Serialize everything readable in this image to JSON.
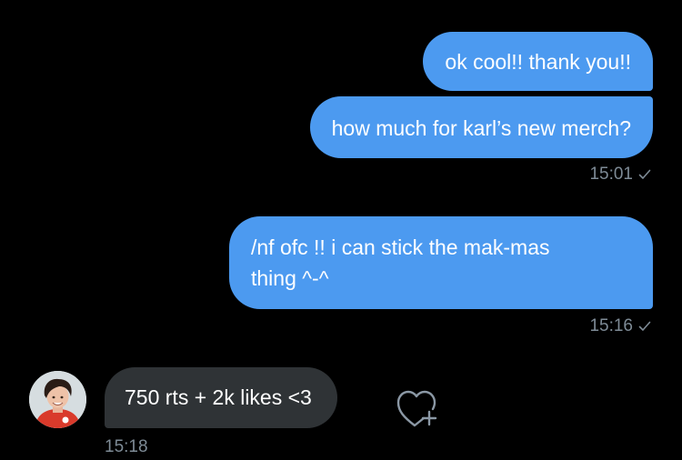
{
  "conversation": {
    "messages": [
      {
        "direction": "outgoing",
        "text": "ok cool!! thank you!!"
      },
      {
        "direction": "outgoing",
        "text": "how much for karl’s new merch?",
        "time": "15:01"
      },
      {
        "direction": "outgoing",
        "text": "/nf ofc !! i can stick the mak-mas\nthing ^-^",
        "time": "15:16"
      },
      {
        "direction": "incoming",
        "text": "750 rts + 2k likes <3",
        "time": "15:18"
      }
    ]
  },
  "icons": {
    "read_receipt": "checkmark-icon",
    "react": "heart-plus-icon",
    "avatar": "user-avatar"
  },
  "colors": {
    "background": "#000000",
    "outgoing_bubble": "#4c9af0",
    "incoming_bubble": "#2f3336",
    "timestamp": "#7e8b96",
    "text": "#ffffff"
  }
}
